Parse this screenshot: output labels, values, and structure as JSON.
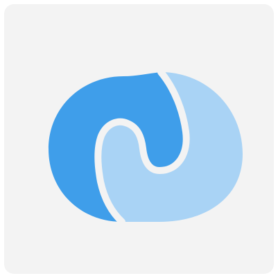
{
  "logo": {
    "icon": "swirl-logo-icon",
    "colors": {
      "background": "#f3f3f3",
      "primary_blue": "#3f9eea",
      "light_blue": "#a9d3f5",
      "gap": "#f3f3f3"
    }
  }
}
